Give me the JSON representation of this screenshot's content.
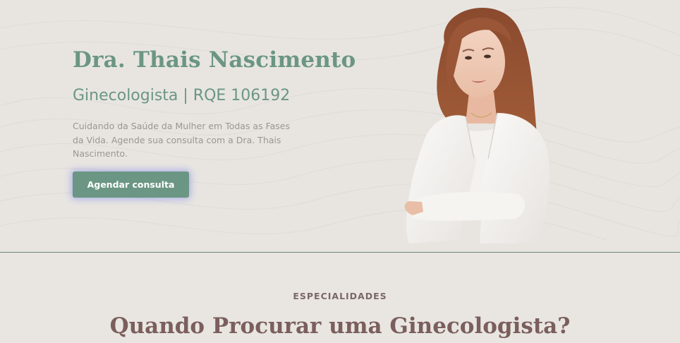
{
  "hero": {
    "name": "Dra. Thais Nascimento",
    "subtitle": "Ginecologista | RQE 106192",
    "description": "Cuidando da Saúde da Mulher em Todas as Fases da Vida. Agende sua consulta com a Dra. Thais Nascimento.",
    "cta_label": "Agendar consulta",
    "portrait_icon": "doctor-portrait"
  },
  "specialties": {
    "eyebrow": "ESPECIALIDADES",
    "title": "Quando Procurar uma Ginecologista?"
  },
  "colors": {
    "accent_green": "#6b9683",
    "heading_mauve": "#7b5f5c",
    "background": "#e9e6e2",
    "body_text": "#9b9591"
  }
}
